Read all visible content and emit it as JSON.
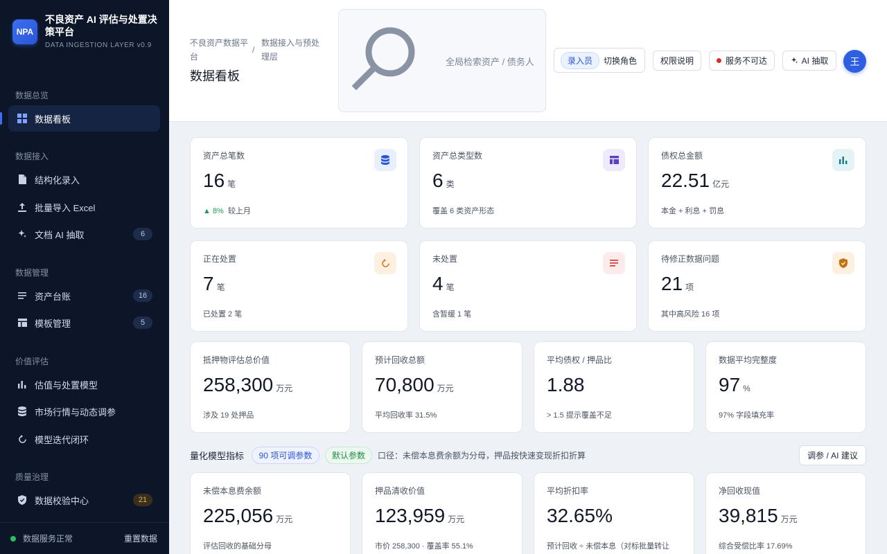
{
  "brand": {
    "logo": "NPA",
    "title": "不良资产 AI 评估与处置决策平台",
    "subtitle": "DATA INGESTION LAYER v0.9"
  },
  "sidebar": {
    "sections": {
      "overview": "数据总览",
      "ingest": "数据接入",
      "manage": "数据管理",
      "valuation": "价值评估",
      "quality": "质量治理"
    },
    "items": {
      "dashboard": {
        "label": "数据看板",
        "icon": "grid-icon"
      },
      "structured": {
        "label": "结构化录入",
        "icon": "file-icon"
      },
      "excel": {
        "label": "批量导入 Excel",
        "icon": "upload-icon"
      },
      "doc_ai": {
        "label": "文档 AI 抽取",
        "icon": "sparkle-icon",
        "badge": "6"
      },
      "ledger": {
        "label": "资产台账",
        "icon": "list-icon",
        "badge": "16"
      },
      "templates": {
        "label": "模板管理",
        "icon": "template-icon",
        "badge": "5"
      },
      "model": {
        "label": "估值与处置模型",
        "icon": "bar-chart-icon"
      },
      "market": {
        "label": "市场行情与动态调参",
        "icon": "database-icon"
      },
      "iteration": {
        "label": "模型迭代闭环",
        "icon": "refresh-icon"
      },
      "validation": {
        "label": "数据校验中心",
        "icon": "shield-icon",
        "badge": "21"
      }
    },
    "footer": {
      "status": "数据服务正常",
      "reset": "重置数据"
    }
  },
  "topbar": {
    "breadcrumb_root": "不良资产数据平台",
    "breadcrumb_sep": "/",
    "breadcrumb_current": "数据接入与预处理层",
    "page_title": "数据看板",
    "search_placeholder": "全局检索资产 / 债务人",
    "role_chip": "录入员",
    "role_switch": "切换角色",
    "perm_btn": "权限说明",
    "service_btn": "服务不可达",
    "ai_btn": "AI 抽取",
    "avatar": "王"
  },
  "colors": {
    "accent": "#2c55d6",
    "sidebar_bg": "#0d1628",
    "ok": "#22c55e",
    "danger": "#d32f2f"
  },
  "stats_row1": [
    {
      "label": "资产总笔数",
      "value": "16",
      "unit": "笔",
      "trend": "▲ 8%",
      "note": "较上月",
      "icon": "database-icon"
    },
    {
      "label": "资产总类型数",
      "value": "6",
      "unit": "类",
      "note": "覆盖 6 类资产形态",
      "icon": "template-icon"
    },
    {
      "label": "债权总金额",
      "value": "22.51",
      "unit": "亿元",
      "note": "本金 + 利息 + 罚息",
      "icon": "bar-chart-icon"
    }
  ],
  "stats_row2": [
    {
      "label": "正在处置",
      "value": "7",
      "unit": "笔",
      "note": "已处置 2 笔",
      "icon": "refresh-icon"
    },
    {
      "label": "未处置",
      "value": "4",
      "unit": "笔",
      "note": "含暂缓 1 笔",
      "icon": "lines-icon"
    },
    {
      "label": "待修正数据问题",
      "value": "21",
      "unit": "项",
      "note": "其中高风险 16 项",
      "icon": "shield-icon"
    }
  ],
  "stats_row3": [
    {
      "label": "抵押物评估总价值",
      "value": "258,300",
      "unit": "万元",
      "note": "涉及 19 处押品"
    },
    {
      "label": "预计回收总额",
      "value": "70,800",
      "unit": "万元",
      "note": "平均回收率 31.5%"
    },
    {
      "label": "平均债权 / 押品比",
      "value": "1.88",
      "unit": "",
      "note": "> 1.5 提示覆盖不足"
    },
    {
      "label": "数据平均完整度",
      "value": "97",
      "unit": "%",
      "note": "97% 字段填充率"
    }
  ],
  "kpi": {
    "title": "量化模型指标",
    "pill_params": "90 项可调参数",
    "pill_default": "默认参数",
    "desc": "口径：未偿本息费余额为分母，押品按快速变现折扣折算",
    "tune_btn": "调参 / AI 建议"
  },
  "stats_row4": [
    {
      "label": "未偿本息费余额",
      "value": "225,056",
      "unit": "万元",
      "note": "评估回收的基础分母"
    },
    {
      "label": "押品清收价值",
      "value": "123,959",
      "unit": "万元",
      "note": "市价 258,300 · 覆盖率 55.1%"
    },
    {
      "label": "平均折扣率",
      "value": "32.65%",
      "unit": "",
      "note": "预计回收 ÷ 未偿本息（对标批量转让"
    },
    {
      "label": "净回收现值",
      "value": "39,815",
      "unit": "万元",
      "note": "综合受偿比率 17.69%"
    }
  ]
}
